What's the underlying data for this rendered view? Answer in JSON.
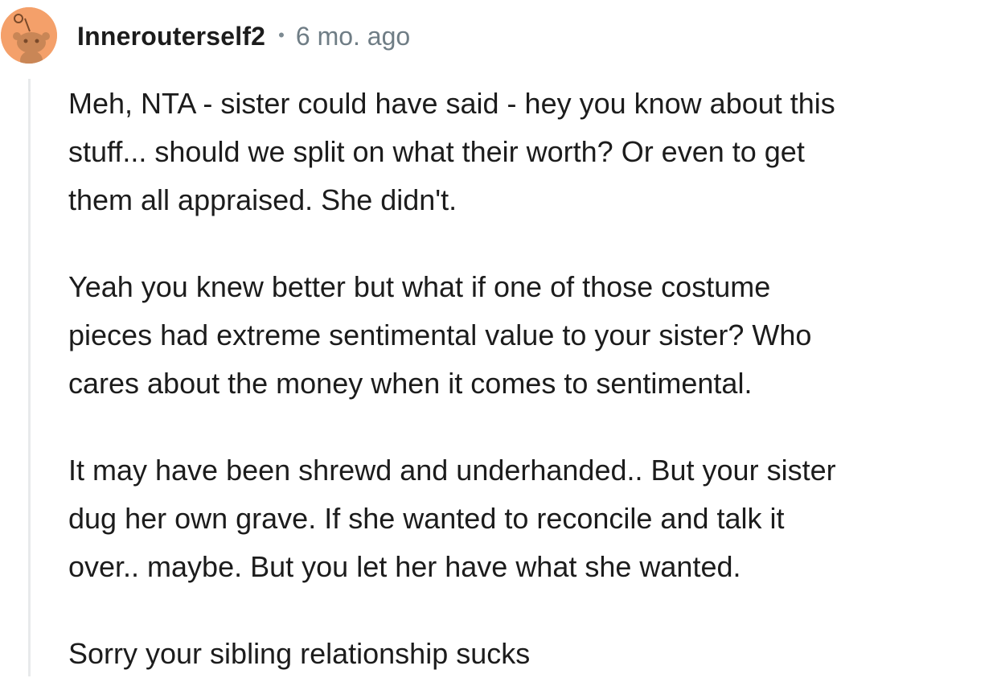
{
  "comment": {
    "author": "Innerouterself2",
    "separator": "•",
    "timestamp": "6 mo. ago",
    "avatar_icon": "snoo-avatar-icon",
    "avatar_color": "#f4a06a",
    "paragraphs": [
      "Meh, NTA - sister could have said - hey you know about this\nstuff... should we split on what their worth? Or even to get\nthem all appraised. She didn't.",
      "Yeah you knew better but what if one of those costume\npieces had extreme sentimental value to your sister? Who\ncares about the money when it comes to sentimental.",
      "It may have been shrewd and underhanded.. But your sister\ndug her own grave. If she wanted to reconcile and talk it\nover.. maybe. But you let her have what she wanted.",
      "Sorry your sibling relationship sucks"
    ]
  }
}
